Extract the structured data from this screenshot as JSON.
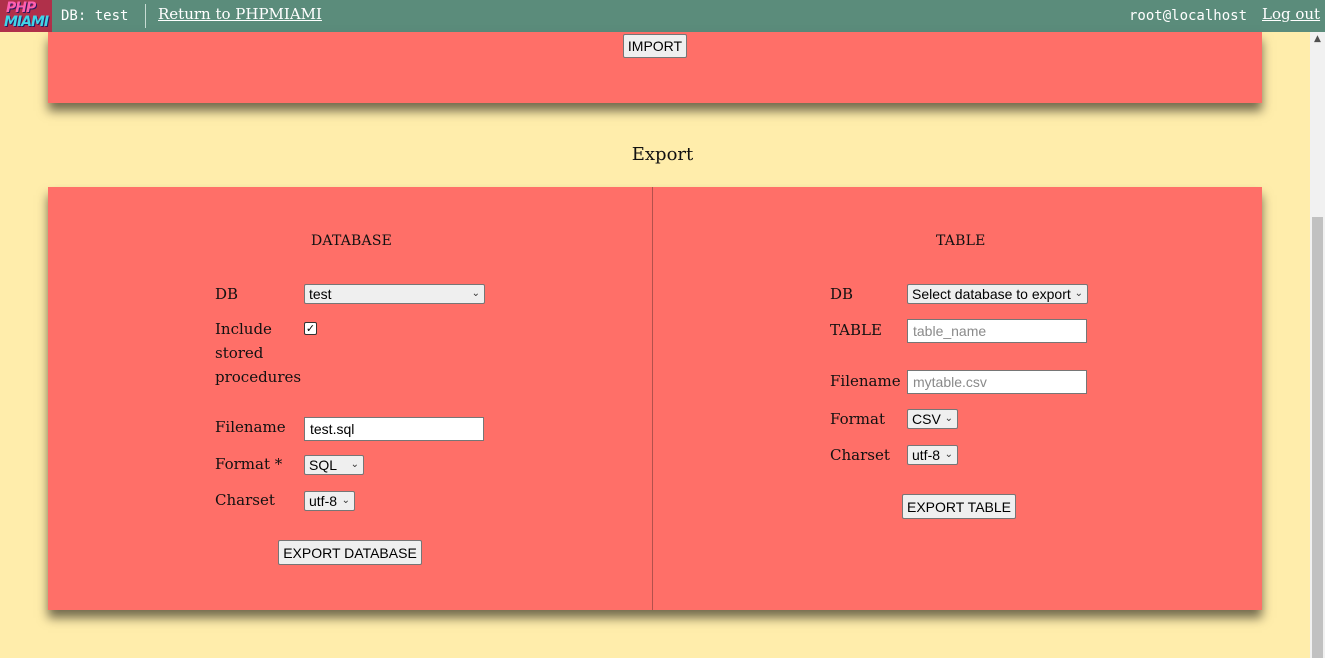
{
  "topbar": {
    "logo_line1": "PHP",
    "logo_line2": "MIAMI",
    "db_label": "DB: test",
    "return_link": "Return to PHPMIAMI",
    "user": "root@localhost",
    "logout": "Log out"
  },
  "import": {
    "button": "IMPORT"
  },
  "export": {
    "title": "Export",
    "database": {
      "heading": "DATABASE",
      "db_label": "DB",
      "db_value": "test",
      "include_label_1": "Include",
      "include_label_2": "stored",
      "include_label_3": "procedures",
      "include_checked": "✓",
      "filename_label": "Filename",
      "filename_value": "test.sql",
      "format_label": "Format *",
      "format_value": "SQL",
      "charset_label": "Charset",
      "charset_value": "utf-8",
      "button": "EXPORT DATABASE"
    },
    "table": {
      "heading": "TABLE",
      "db_label": "DB",
      "db_value": "Select database to export",
      "table_label": "TABLE",
      "table_placeholder": "table_name",
      "filename_label": "Filename",
      "filename_placeholder": "mytable.csv",
      "format_label": "Format",
      "format_value": "CSV",
      "charset_label": "Charset",
      "charset_value": "utf-8",
      "button": "EXPORT TABLE"
    }
  },
  "icons": {
    "chevron": "chevron-down-icon",
    "scroll_up": "arrow-up-icon"
  },
  "colors": {
    "background": "#FFEDAB",
    "topbar": "#5B8C7B",
    "panel": "#FF6F68"
  }
}
